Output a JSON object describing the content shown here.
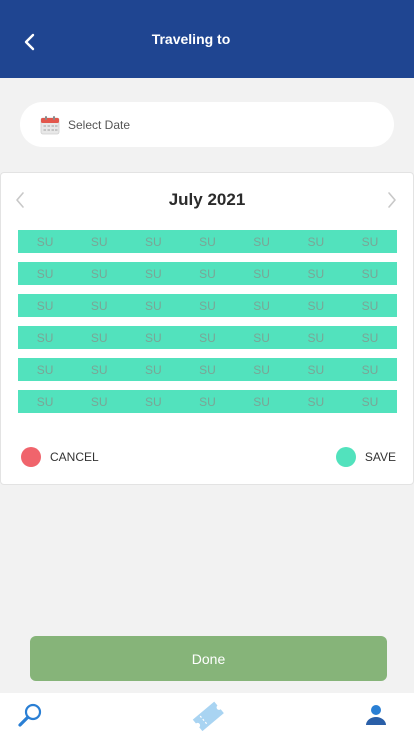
{
  "header": {
    "title": "Traveling to",
    "background_color": "#1f4591",
    "back_icon": "chevron-left-icon"
  },
  "date_field": {
    "placeholder": "Select Date",
    "icon": "calendar-icon"
  },
  "calendar": {
    "month_label": "July 2021",
    "prev_icon": "chevron-left-icon",
    "next_icon": "chevron-right-icon",
    "cell_color": "#52e2bd",
    "weeks": [
      [
        "SU",
        "SU",
        "SU",
        "SU",
        "SU",
        "SU",
        "SU"
      ],
      [
        "SU",
        "SU",
        "SU",
        "SU",
        "SU",
        "SU",
        "SU"
      ],
      [
        "SU",
        "SU",
        "SU",
        "SU",
        "SU",
        "SU",
        "SU"
      ],
      [
        "SU",
        "SU",
        "SU",
        "SU",
        "SU",
        "SU",
        "SU"
      ],
      [
        "SU",
        "SU",
        "SU",
        "SU",
        "SU",
        "SU",
        "SU"
      ],
      [
        "SU",
        "SU",
        "SU",
        "SU",
        "SU",
        "SU",
        "SU"
      ]
    ],
    "cancel_label": "CANCEL",
    "cancel_color": "#f0646c",
    "save_label": "SAVE",
    "save_color": "#52e2bd"
  },
  "done_button": {
    "label": "Done",
    "color": "#86b479"
  },
  "bottom_nav": {
    "items": [
      {
        "icon": "search-icon"
      },
      {
        "icon": "ticket-icon"
      },
      {
        "icon": "user-icon"
      }
    ]
  }
}
